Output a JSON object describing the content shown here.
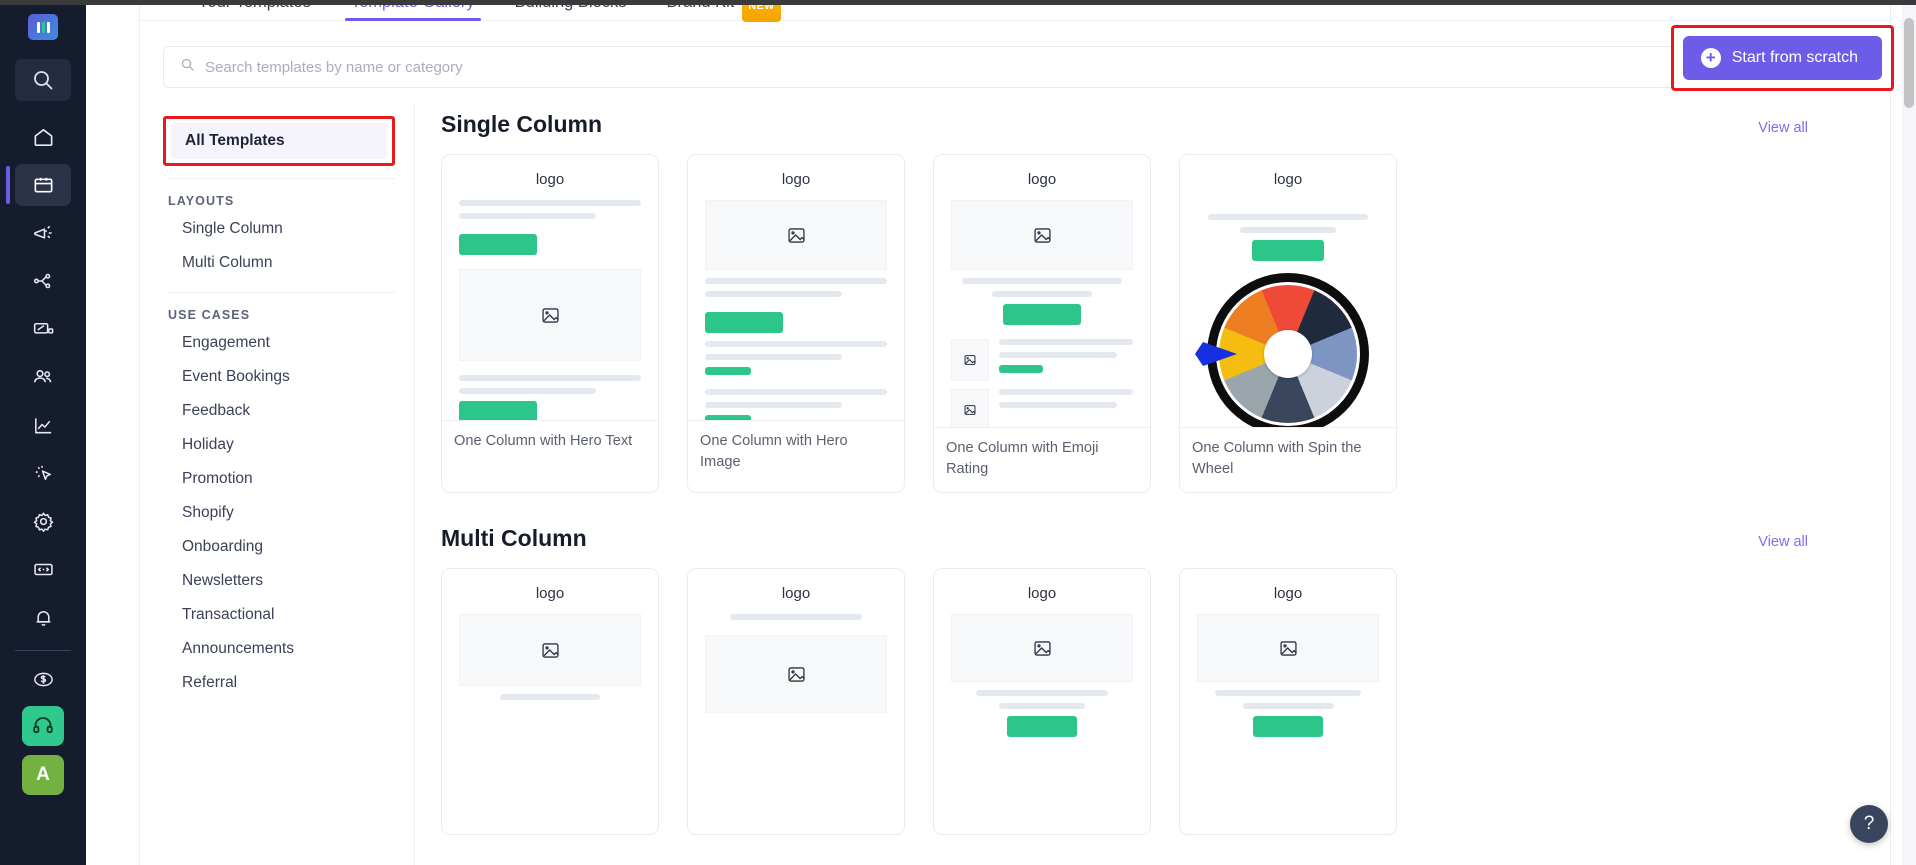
{
  "brand": {
    "avatar_initial": "A"
  },
  "rail": {
    "items": [
      {
        "name": "logo",
        "label": "Mailmodo logo"
      },
      {
        "name": "search-icon",
        "label": "Search"
      },
      {
        "name": "home-icon",
        "label": "Home"
      },
      {
        "name": "templates-icon",
        "label": "Templates"
      },
      {
        "name": "campaigns-icon",
        "label": "Campaigns"
      },
      {
        "name": "journeys-icon",
        "label": "Journeys"
      },
      {
        "name": "forms-icon",
        "label": "Forms"
      },
      {
        "name": "contacts-icon",
        "label": "Contacts"
      },
      {
        "name": "analytics-icon",
        "label": "Analytics"
      },
      {
        "name": "automation-icon",
        "label": "Automation"
      },
      {
        "name": "settings-icon",
        "label": "Settings"
      },
      {
        "name": "developers-icon",
        "label": "Developers"
      },
      {
        "name": "notifications-icon",
        "label": "Notifications"
      },
      {
        "name": "billing-icon",
        "label": "Billing"
      },
      {
        "name": "support-icon",
        "label": "Support"
      }
    ]
  },
  "tabs": [
    {
      "label": "Your Templates",
      "active": false
    },
    {
      "label": "Template Gallery",
      "active": true
    },
    {
      "label": "Building Blocks",
      "active": false
    },
    {
      "label": "Brand Kit",
      "active": false,
      "badge": "NEW"
    }
  ],
  "search": {
    "placeholder": "Search templates by name or category",
    "value": ""
  },
  "actions": {
    "start_from_scratch": "Start from scratch",
    "plus_glyph": "+"
  },
  "filters": {
    "all_templates": "All Templates",
    "groups": [
      {
        "title": "LAYOUTS",
        "items": [
          "Single Column",
          "Multi Column"
        ]
      },
      {
        "title": "USE CASES",
        "items": [
          "Engagement",
          "Event Bookings",
          "Feedback",
          "Holiday",
          "Promotion",
          "Shopify",
          "Onboarding",
          "Newsletters",
          "Transactional",
          "Announcements",
          "Referral"
        ]
      }
    ]
  },
  "sections": [
    {
      "title": "Single Column",
      "view_all": "View all",
      "cards": [
        {
          "logo": "logo",
          "caption": "One Column with Hero Text",
          "kind": "hero-text"
        },
        {
          "logo": "logo",
          "caption": "One Column with Hero Image",
          "kind": "hero-image"
        },
        {
          "logo": "logo",
          "caption": "One Column with Emoji Rating",
          "kind": "emoji-rating"
        },
        {
          "logo": "logo",
          "caption": "One Column with Spin the Wheel",
          "kind": "spin-wheel"
        }
      ]
    },
    {
      "title": "Multi Column",
      "view_all": "View all",
      "cards": [
        {
          "logo": "logo",
          "caption": "",
          "kind": "mc-image-top"
        },
        {
          "logo": "logo",
          "caption": "",
          "kind": "mc-line-image"
        },
        {
          "logo": "logo",
          "caption": "",
          "kind": "mc-image-text"
        },
        {
          "logo": "logo",
          "caption": "",
          "kind": "mc-image-text"
        }
      ]
    }
  ],
  "wheel": {
    "segment_colors": [
      "#f5bd10",
      "#ed7f22",
      "#ef4a38",
      "#1f2b3d",
      "#7e95c4",
      "#ccd2dc",
      "#39465c",
      "#9aa5ac"
    ],
    "pointer_color": "#1430e0",
    "rim_color": "#0d0d0d",
    "hub_color": "#ffffff"
  },
  "help": {
    "glyph": "?"
  },
  "colors": {
    "accent_purple": "#6c5ce7",
    "link_purple": "#7b6ef0",
    "green": "#2cc58a",
    "annotation_red": "#e8191c",
    "rail_bg": "#151c2e",
    "badge_orange": "#f5a300"
  }
}
